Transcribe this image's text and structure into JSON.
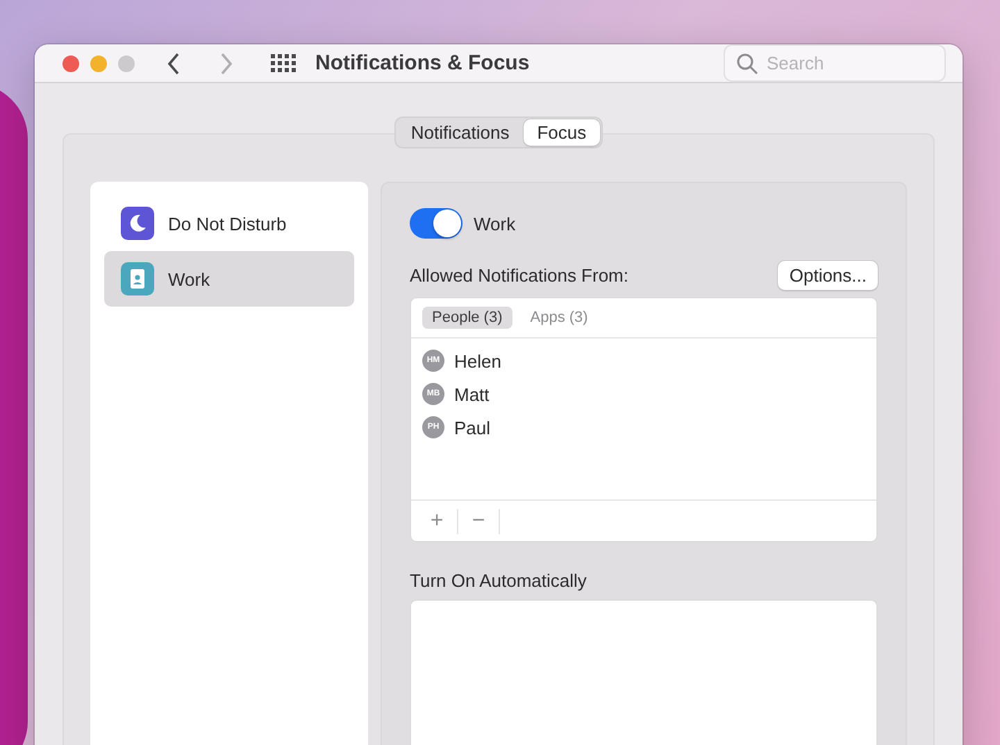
{
  "window": {
    "title": "Notifications & Focus",
    "search": {
      "placeholder": "Search"
    }
  },
  "tabs": [
    {
      "label": "Notifications",
      "selected": false
    },
    {
      "label": "Focus",
      "selected": true
    }
  ],
  "sidebar": {
    "items": [
      {
        "label": "Do Not Disturb",
        "kind": "moon",
        "selected": false,
        "color": "#5d55d6"
      },
      {
        "label": "Work",
        "kind": "badge",
        "selected": true,
        "color": "#4aa7bd"
      }
    ]
  },
  "focus": {
    "toggle": {
      "label": "Work",
      "on": true
    },
    "allowed_label": "Allowed Notifications From:",
    "options_button": "Options...",
    "subtabs": [
      {
        "label": "People (3)",
        "selected": true
      },
      {
        "label": "Apps (3)",
        "selected": false
      }
    ],
    "people": [
      {
        "initials": "HM",
        "name": "Helen"
      },
      {
        "initials": "MB",
        "name": "Matt"
      },
      {
        "initials": "PH",
        "name": "Paul"
      }
    ],
    "add": "+",
    "remove": "−",
    "auto_label": "Turn On Automatically"
  }
}
